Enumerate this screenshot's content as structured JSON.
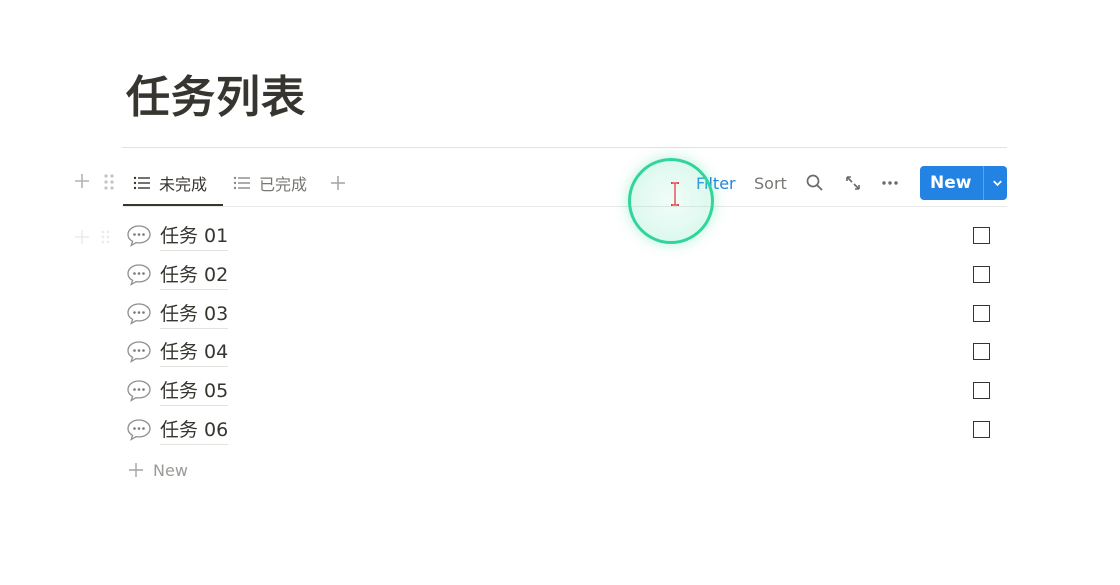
{
  "page": {
    "title": "任务列表"
  },
  "views": {
    "tabs": [
      {
        "label": "未完成",
        "active": true
      },
      {
        "label": "已完成",
        "active": false
      }
    ]
  },
  "toolbar": {
    "filter_label": "Filter",
    "sort_label": "Sort",
    "new_label": "New",
    "icons": [
      "search-icon",
      "expand-icon",
      "more-icon",
      "chevron-down-icon"
    ],
    "accent_color": "#2383e2"
  },
  "tasks": [
    {
      "label": "任务 01",
      "done": false
    },
    {
      "label": "任务 02",
      "done": false
    },
    {
      "label": "任务 03",
      "done": false
    },
    {
      "label": "任务 04",
      "done": false
    },
    {
      "label": "任务 05",
      "done": false
    },
    {
      "label": "任务 06",
      "done": false
    }
  ],
  "list": {
    "add_label": "New"
  },
  "cursor": {
    "highlight_color": "#2fd69a"
  }
}
